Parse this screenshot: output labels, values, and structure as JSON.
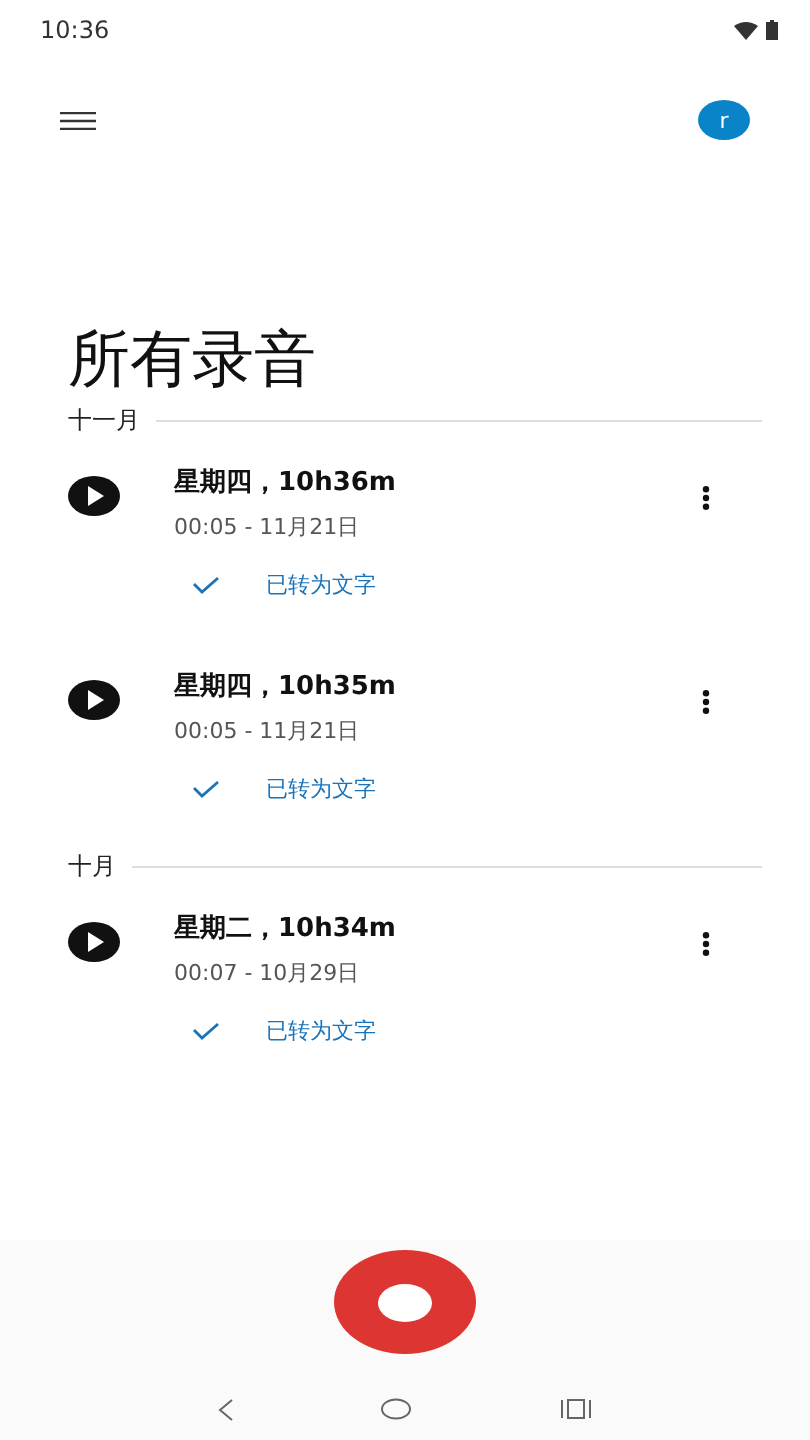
{
  "status_bar": {
    "time": "10:36"
  },
  "header": {
    "avatar": "r"
  },
  "title": "所有录音",
  "sections": [
    {
      "label": "十一月",
      "recordings": [
        {
          "title": "星期四，10h36m",
          "meta": "00:05 - 11月21日",
          "transcribed": true,
          "status": "已转为文字"
        },
        {
          "title": "星期四，10h35m",
          "meta": "00:05 - 11月21日",
          "transcribed": true,
          "status": "已转为文字"
        }
      ]
    },
    {
      "label": "十月",
      "recordings": [
        {
          "title": "星期二，10h34m",
          "meta": "00:07 - 10月29日",
          "transcribed": true,
          "status": "已转为文字"
        }
      ]
    }
  ]
}
